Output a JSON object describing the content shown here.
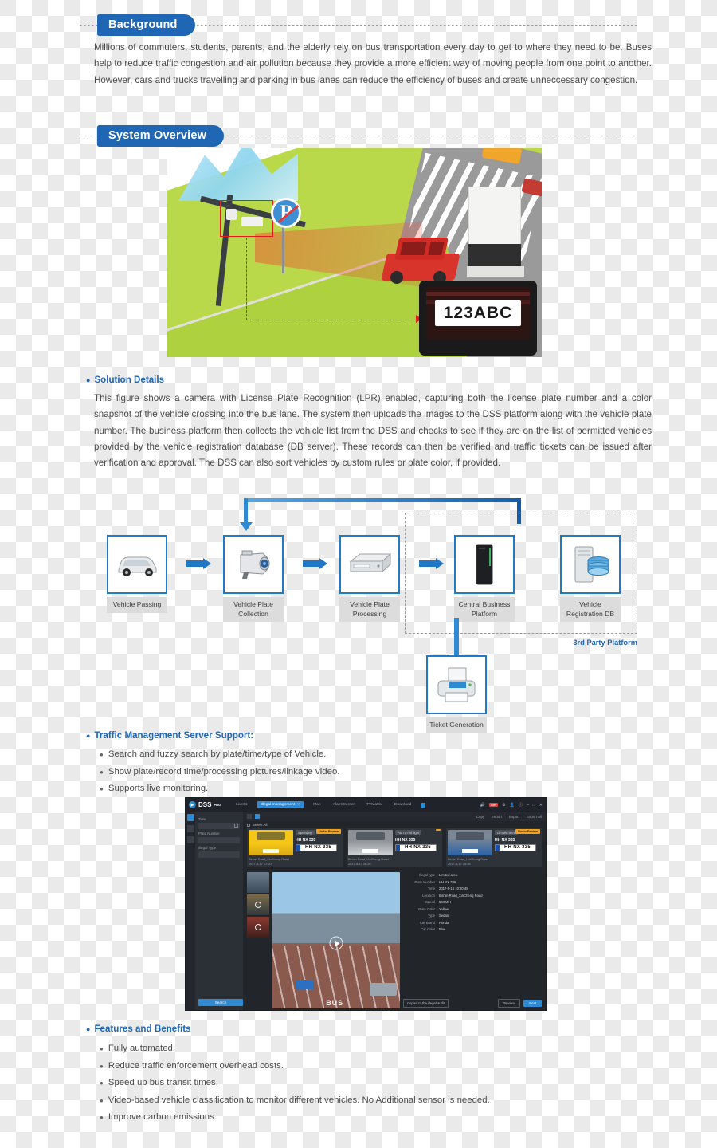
{
  "sections": {
    "background": {
      "title": "Background",
      "paragraph": "Millions of commuters, students, parents, and the elderly rely on bus transportation every day to get to where they need to be. Buses help to reduce traffic congestion and air pollution because they provide a more efficient way of moving people from one point to another. However, cars and trucks travelling and parking in bus lanes can reduce the efficiency of buses and create unneccessary congestion."
    },
    "system_overview": {
      "title": "System Overview",
      "illustration": {
        "sign_letter": "P",
        "lpr_plate": "123ABC",
        "camera_highlight": "red-box-around-lpr-camera"
      },
      "solution_details": {
        "heading": "Solution Details",
        "paragraph": "This figure shows a camera with License Plate Recognition (LPR) enabled, capturing both the license plate number and a color snapshot of the vehicle crossing into the bus lane. The system then uploads the images to the DSS platform along with the vehicle plate number. The business platform then collects the vehicle list from the DSS and checks to see if they are on the list of permitted vehicles provided by the vehicle registration database (DB server). These records can then be verified and traffic tickets can be issued after verification and approval. The DSS can also sort vehicles by custom rules or plate color, if provided."
      },
      "flow": {
        "nodes": [
          {
            "label": "Vehicle Passing",
            "icon": "car-icon"
          },
          {
            "label": "Vehicle Plate Collection",
            "icon": "camera-icon"
          },
          {
            "label": "Vehicle Plate Processing",
            "icon": "server-box-icon"
          },
          {
            "label": "Central Business Platform",
            "icon": "tower-server-icon"
          },
          {
            "label": "Vehicle Registration DB",
            "icon": "database-icon"
          },
          {
            "label": "Ticket Generation",
            "icon": "printer-icon"
          }
        ],
        "group_label": "3rd Party Platform"
      }
    },
    "traffic_management": {
      "heading": "Traffic Management Server Support:",
      "items": [
        "Search and fuzzy search by plate/time/type of Vehicle.",
        "Show plate/record time/processing pictures/linkage video.",
        "Supports live monitoring."
      ]
    },
    "features": {
      "heading": "Features and Benefits",
      "items": [
        "Fully automated.",
        "Reduce traffic enforcement overhead costs.",
        "Speed up bus transit times.",
        "Video-based vehicle classification to monitor different vehicles. No Additional sensor is needed.",
        "Improve carbon emissions."
      ]
    }
  },
  "dss": {
    "brand": "DSS",
    "brand_sup": "PRO",
    "tabs": [
      {
        "label": "Live01",
        "active": false
      },
      {
        "label": "Illegal management",
        "active": true,
        "close": "×"
      },
      {
        "label": "Map",
        "active": false
      },
      {
        "label": "AlarmCenter",
        "active": false
      },
      {
        "label": "TVMatrix",
        "active": false
      },
      {
        "label": "Download",
        "active": false
      }
    ],
    "title_right": {
      "alarm_count": "99+",
      "icons": [
        "speaker-icon",
        "gear-icon",
        "user-icon",
        "help-icon",
        "minimize-icon",
        "maximize-icon",
        "close-icon"
      ]
    },
    "sidebar": {
      "fields": [
        {
          "label": "Time",
          "value": ""
        },
        {
          "label": "Plate Number",
          "value": ""
        },
        {
          "label": "Illegal Type",
          "value": ""
        }
      ],
      "search_button": "Search"
    },
    "toolbar": {
      "select_all": "Select All",
      "actions": [
        "Copy",
        "Import",
        "Export",
        "Export All"
      ]
    },
    "cards": [
      {
        "tag": "Speeding",
        "plate_text": "HH NX 335",
        "plate_image": "HH NX 335",
        "badge": "Under Review",
        "location": "Bin'an Road_XinCheng Road",
        "time": "2017-5-17 17:20",
        "photo": "yellow-car"
      },
      {
        "tag": "Run a red light",
        "plate_text": "HH NX 335",
        "plate_image": "HH NX 335",
        "badge": "",
        "location": "Bin'an Road_XinCheng Road",
        "time": "2017-5-17 16:20",
        "photo": "silver-car"
      },
      {
        "tag": "Limited area",
        "plate_text": "HH NX 335",
        "plate_image": "HH NX 335",
        "badge": "Under Review",
        "location": "Bin'an Road_XinCheng Road",
        "time": "2017-5-17 15:35",
        "photo": "blue-car"
      }
    ],
    "detail": {
      "video_overlay_text": "BUS",
      "rows": [
        {
          "key": "Illegal type",
          "value": "Limited area"
        },
        {
          "key": "Plate Number",
          "value": "HH NX 335"
        },
        {
          "key": "Time",
          "value": "2017-5-16 10:20:45"
        },
        {
          "key": "Location",
          "value": "Bin'an  Road_XinCheng Road"
        },
        {
          "key": "Speed",
          "value": "50KM/H"
        },
        {
          "key": "Plate Color",
          "value": "Yellow"
        },
        {
          "key": "Type",
          "value": "Sedan"
        },
        {
          "key": "Car Brand",
          "value": "Honda"
        },
        {
          "key": "Car Color",
          "value": "Blue"
        }
      ],
      "buttons": {
        "copy": "Copied to the illegal audit",
        "previous": "Previous",
        "next": "Next"
      }
    }
  },
  "colors": {
    "brand_blue": "#1f66b5",
    "accent_blue": "#2f8ad4",
    "alert_red": "#e0453c",
    "badge_orange": "#f0a020"
  }
}
